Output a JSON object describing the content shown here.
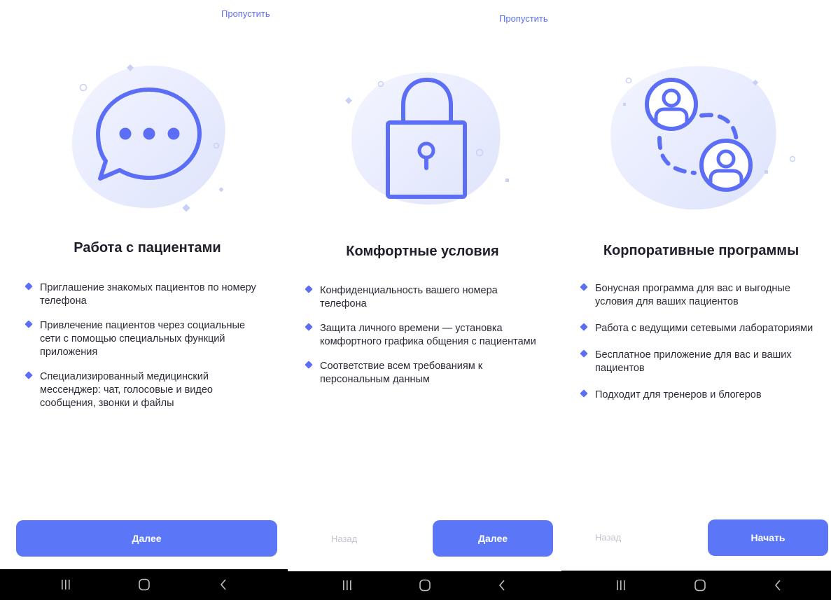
{
  "colors": {
    "accent": "#5b77f8",
    "icon": "#5b6ef5",
    "blob": "#e6e9fd",
    "back_disabled": "#c3c6cf",
    "navbar": "#000000"
  },
  "screens": [
    {
      "skip_label": "Пропустить",
      "illustration_icon": "chat-bubble-icon",
      "title": "Работа с пациентами",
      "bullets": [
        "Приглашение знакомых пациентов по номеру телефона",
        "Привлечение пациентов через социальные сети с помощью специальных функций приложения",
        "Специализированный медицинский мессенджер: чат, голосовые и видео сообщения, звонки и файлы"
      ],
      "primary_label": "Далее"
    },
    {
      "skip_label": "Пропустить",
      "illustration_icon": "padlock-icon",
      "title": "Комфортные условия",
      "bullets": [
        "Конфиденциальность вашего номера телефона",
        "Защита личного времени — установка комфортного графика общения с пациентами",
        "Соответствие всем требованиям к персональным данным"
      ],
      "back_label": "Назад",
      "primary_label": "Далее"
    },
    {
      "illustration_icon": "users-exchange-icon",
      "title": "Корпоративные программы",
      "bullets": [
        "Бонусная программа для вас и выгодные условия для ваших пациентов",
        "Работа с ведущими сетевыми лабораториями",
        "Бесплатное приложение для вас и ваших пациентов",
        "Подходит для тренеров и блогеров"
      ],
      "back_label": "Назад",
      "primary_label": "Начать"
    }
  ],
  "navbar_icons": [
    "recent-apps-icon",
    "home-icon",
    "back-icon"
  ]
}
